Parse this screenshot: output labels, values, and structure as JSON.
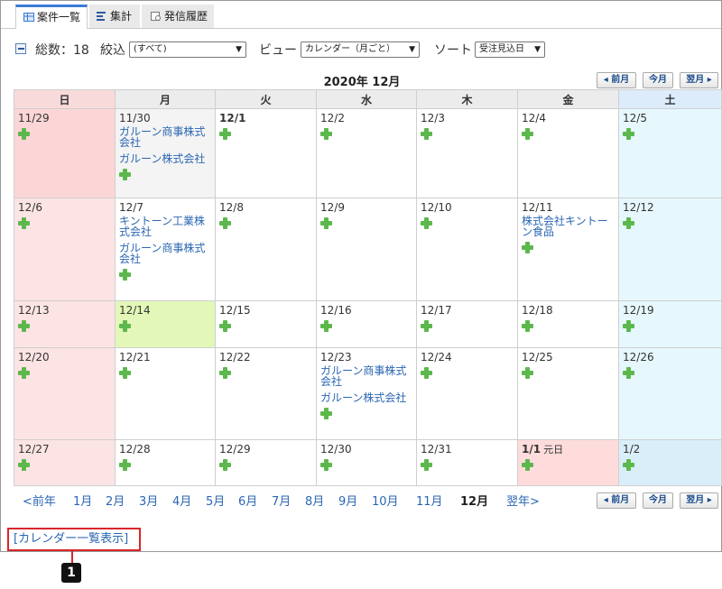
{
  "tabs": [
    {
      "label": "案件一覧",
      "icon": "table-icon"
    },
    {
      "label": "集計",
      "icon": "chart-icon"
    },
    {
      "label": "発信履歴",
      "icon": "history-icon"
    }
  ],
  "filter": {
    "total_label": "総数：18",
    "narrow_label": "絞込",
    "narrow_value": "(すべて)",
    "view_label": "ビュー",
    "view_value": "カレンダー（月ごと）",
    "sort_label": "ソート",
    "sort_value": "受注見込日"
  },
  "calendar": {
    "title": "2020年 12月",
    "nav": {
      "prev": "前月",
      "today": "今月",
      "next": "翌月"
    },
    "weekdays": [
      "日",
      "月",
      "火",
      "水",
      "木",
      "金",
      "土"
    ],
    "weeks": [
      [
        {
          "date": "11/29",
          "events": []
        },
        {
          "date": "11/30",
          "events": [
            "ガルーン商事株式会社",
            "ガルーン株式会社"
          ]
        },
        {
          "date": "12/1",
          "events": []
        },
        {
          "date": "12/2",
          "events": []
        },
        {
          "date": "12/3",
          "events": []
        },
        {
          "date": "12/4",
          "events": []
        },
        {
          "date": "12/5",
          "events": []
        }
      ],
      [
        {
          "date": "12/6",
          "events": []
        },
        {
          "date": "12/7",
          "events": [
            "キントーン工業株式会社",
            "ガルーン商事株式会社"
          ]
        },
        {
          "date": "12/8",
          "events": []
        },
        {
          "date": "12/9",
          "events": []
        },
        {
          "date": "12/10",
          "events": []
        },
        {
          "date": "12/11",
          "events": [
            "株式会社キントーン食品"
          ]
        },
        {
          "date": "12/12",
          "events": []
        }
      ],
      [
        {
          "date": "12/13",
          "events": []
        },
        {
          "date": "12/14",
          "events": []
        },
        {
          "date": "12/15",
          "events": []
        },
        {
          "date": "12/16",
          "events": []
        },
        {
          "date": "12/17",
          "events": []
        },
        {
          "date": "12/18",
          "events": []
        },
        {
          "date": "12/19",
          "events": []
        }
      ],
      [
        {
          "date": "12/20",
          "events": []
        },
        {
          "date": "12/21",
          "events": []
        },
        {
          "date": "12/22",
          "events": []
        },
        {
          "date": "12/23",
          "events": [
            "ガルーン商事株式会社",
            "ガルーン株式会社"
          ]
        },
        {
          "date": "12/24",
          "events": []
        },
        {
          "date": "12/25",
          "events": []
        },
        {
          "date": "12/26",
          "events": []
        }
      ],
      [
        {
          "date": "12/27",
          "events": []
        },
        {
          "date": "12/28",
          "events": []
        },
        {
          "date": "12/29",
          "events": []
        },
        {
          "date": "12/30",
          "events": []
        },
        {
          "date": "12/31",
          "events": []
        },
        {
          "date": "1/1",
          "holiday": "元日",
          "events": []
        },
        {
          "date": "1/2",
          "events": []
        }
      ]
    ],
    "months_nav": [
      "<前年",
      "1月",
      "2月",
      "3月",
      "4月",
      "5月",
      "6月",
      "7月",
      "8月",
      "9月",
      "10月",
      "11月",
      "12月",
      "翌年>"
    ],
    "current_month": "12月"
  },
  "list_link": "[カレンダー一覧表示]",
  "callout": "1",
  "colors": {
    "link": "#2a66b3",
    "sunday_bg": "#fce4e4",
    "saturday_bg": "#e6f8fd",
    "today_bg": "#e3f8b8",
    "holiday_bg": "#ffdcdc",
    "add_icon": "#5cb84c",
    "highlight": "#d9262b"
  }
}
